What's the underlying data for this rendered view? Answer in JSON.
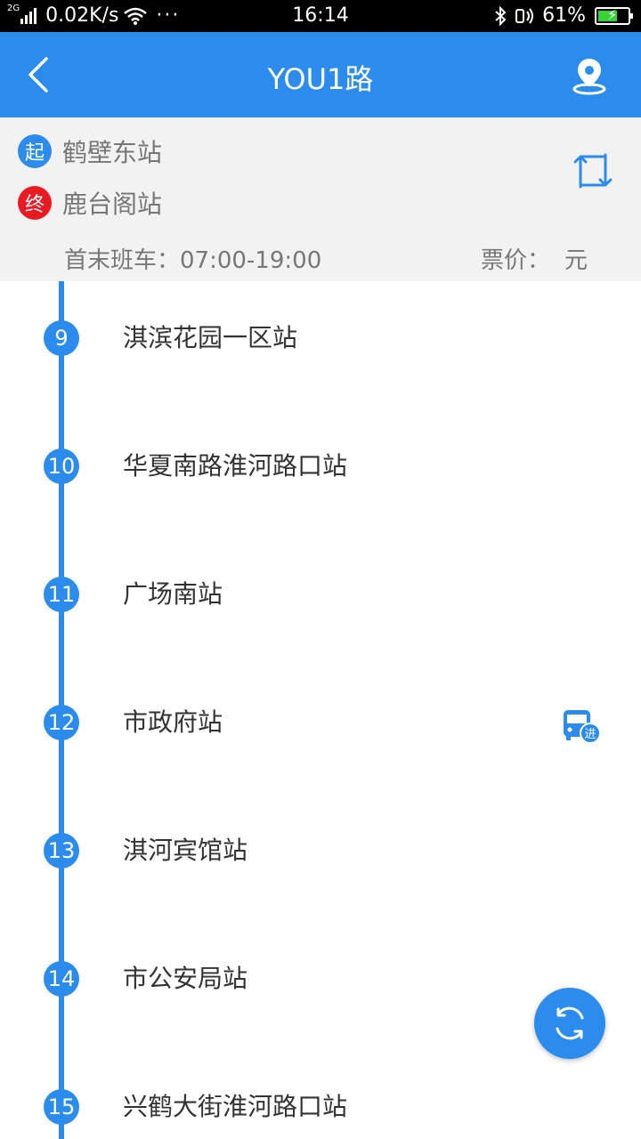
{
  "status_bar": {
    "network_type": "2G",
    "speed": "0.02K/s",
    "more": "···",
    "time": "16:14",
    "battery": "61%"
  },
  "header": {
    "title": "YOU1路",
    "back_icon": "chevron-left-icon",
    "map_icon": "location-pin-icon"
  },
  "route": {
    "start_tag": "起",
    "start_name": "鹤壁东站",
    "end_tag": "终",
    "end_name": "鹿台阁站",
    "hours": "首末班车：07:00-19:00",
    "fare_label": "票价：",
    "fare_value": "元"
  },
  "stops": [
    {
      "num": "9",
      "name": "淇滨花园一区站"
    },
    {
      "num": "10",
      "name": "华夏南路淮河路口站"
    },
    {
      "num": "11",
      "name": "广场南站"
    },
    {
      "num": "12",
      "name": "市政府站",
      "bus_tag": "进"
    },
    {
      "num": "13",
      "name": "淇河宾馆站"
    },
    {
      "num": "14",
      "name": "市公安局站"
    },
    {
      "num": "15",
      "name": "兴鹤大街淮河路口站"
    }
  ],
  "colors": {
    "primary": "#2b8ced",
    "end_red": "#e81b23"
  }
}
